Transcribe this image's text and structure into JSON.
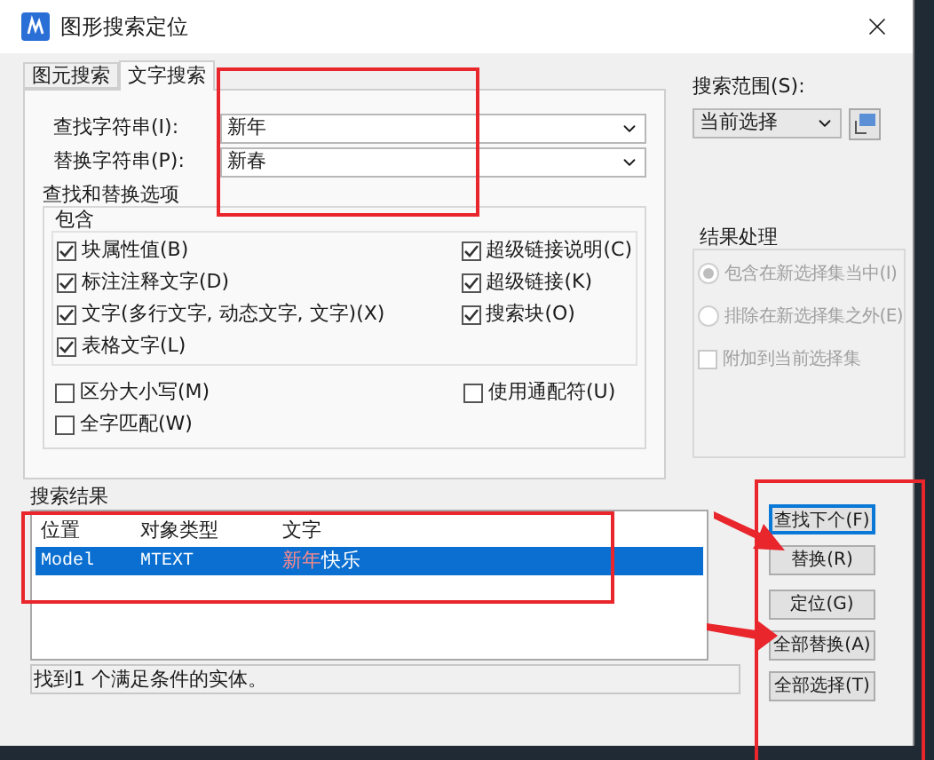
{
  "window": {
    "title": "图形搜索定位"
  },
  "tabs": [
    {
      "label": "图元搜索",
      "selected": false
    },
    {
      "label": "文字搜索",
      "selected": true
    }
  ],
  "find_field": {
    "label": "查找字符串(I):",
    "value": "新年"
  },
  "replace_field": {
    "label": "替换字符串(P):",
    "value": "新春"
  },
  "options": {
    "title": "查找和替换选项",
    "include": {
      "title": "包含",
      "left": [
        {
          "label": "块属性值(B)",
          "checked": true
        },
        {
          "label": "标注注释文字(D)",
          "checked": true
        },
        {
          "label": "文字(多行文字, 动态文字, 文字)(X)",
          "checked": true
        },
        {
          "label": "表格文字(L)",
          "checked": true
        }
      ],
      "right": [
        {
          "label": "超级链接说明(C)",
          "checked": true
        },
        {
          "label": "超级链接(K)",
          "checked": true
        },
        {
          "label": "搜索块(O)",
          "checked": true
        }
      ]
    },
    "left": [
      {
        "label": "区分大小写(M)",
        "checked": false
      },
      {
        "label": "全字匹配(W)",
        "checked": false
      }
    ],
    "right": [
      {
        "label": "使用通配符(U)",
        "checked": false
      }
    ]
  },
  "search_scope": {
    "label": "搜索范围(S):",
    "value": "当前选择"
  },
  "result_handling": {
    "title": "结果处理",
    "items": [
      {
        "kind": "radio",
        "label": "包含在新选择集当中(I)",
        "selected": true,
        "disabled": true
      },
      {
        "kind": "radio",
        "label": "排除在新选择集之外(E)",
        "selected": false,
        "disabled": true
      },
      {
        "kind": "checkbox",
        "label": "附加到当前选择集",
        "checked": false,
        "disabled": true
      }
    ]
  },
  "results": {
    "title": "搜索结果",
    "columns": [
      "位置",
      "对象类型",
      "文字"
    ],
    "rows": [
      {
        "selected": true,
        "cells": [
          "Model",
          "MTEXT"
        ],
        "text_parts": [
          {
            "text": "新年",
            "match": true
          },
          {
            "text": "快乐",
            "match": false
          }
        ]
      }
    ]
  },
  "status_bar": "找到1 个满足条件的实体。",
  "buttons": [
    {
      "label": "查找下个(F)",
      "default": true
    },
    {
      "label": "替换(R)",
      "default": false
    },
    {
      "label": "定位(G)",
      "default": false
    },
    {
      "label": "全部替换(A)",
      "default": false
    },
    {
      "label": "全部选择(T)",
      "default": false
    }
  ],
  "annotations": [
    {
      "kind": "box"
    },
    {
      "kind": "box"
    },
    {
      "kind": "box"
    },
    {
      "kind": "arrow"
    },
    {
      "kind": "arrow"
    }
  ]
}
